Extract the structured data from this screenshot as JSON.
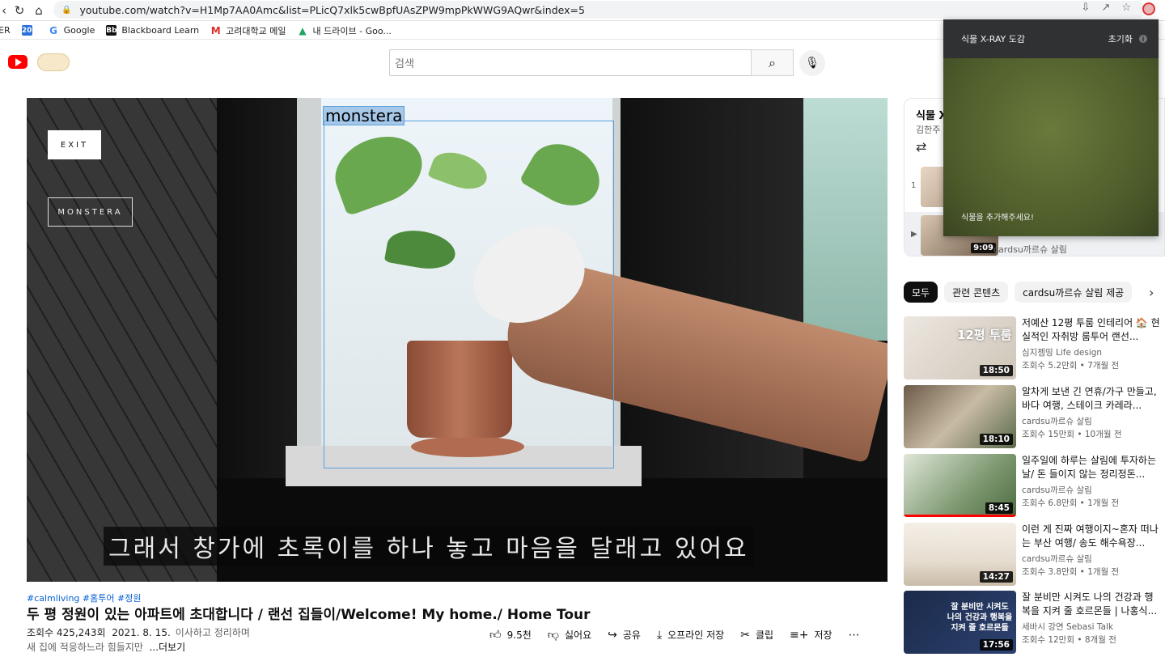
{
  "browser": {
    "url": "youtube.com/watch?v=H1Mp7AA0Amc&list=PLicQ7xlk5cwBpfUAsZPW9mpPkWWG9AQwr&index=5",
    "bookmarks": [
      {
        "label": "ER",
        "icon": "naver-icon"
      },
      {
        "label": "20",
        "icon": "calendar-icon"
      },
      {
        "label": "Google",
        "icon": "google-icon"
      },
      {
        "label": "Blackboard Learn",
        "icon": "blackboard-icon"
      },
      {
        "label": "고려대학교 메일",
        "icon": "gmail-icon"
      },
      {
        "label": "내 드라이브 - Goo...",
        "icon": "drive-icon"
      }
    ]
  },
  "header": {
    "search_placeholder": "검색"
  },
  "player": {
    "detection_label": "monstera",
    "exit_label": "EXIT",
    "tag_label": "MONSTERA",
    "caption": "그래서 창가에 초록이를 하나 놓고 마음을 달래고 있어요"
  },
  "video": {
    "hashtags": "#calmliving #홈투어 #정원",
    "title": "두 평 정원이 있는 아파트에 초대합니다 / 랜선 집들이/Welcome! My home./ Home Tour",
    "views": "조회수 425,243회",
    "date": "2021. 8. 15.",
    "desc_line1": "이사하고 정리하며",
    "desc_line2": "새 집에 적응하느라 힘들지만",
    "more": "...더보기",
    "actions": {
      "like": "9.5천",
      "dislike": "싫어요",
      "share": "공유",
      "download": "오프라인 저장",
      "clip": "클립",
      "save": "저장"
    }
  },
  "playlist": {
    "title": "식물 X-",
    "owner": "김한주",
    "item1_index": "1",
    "item2_duration": "9:09",
    "item2_channel": "cardsu까르슈 살림"
  },
  "xray_panel": {
    "title": "식물 X-RAY 도감",
    "reset": "초기화",
    "info": "i",
    "hint": "식물을 추가해주세요!"
  },
  "chips": [
    "모두",
    "관련 콘텐츠",
    "cardsu까르슈 살림 제공"
  ],
  "recommendations": [
    {
      "title": "저예산 12평 투룸 인테리어 🏠 현실적인 자취방 룸투어 랜선...",
      "channel": "심지젬띵 Life design",
      "stats": "조회수 5.2만회 • 7개월 전",
      "duration": "18:50",
      "thumb_text": "12평 투룸",
      "progress": 0
    },
    {
      "title": "알차게 보낸 긴 연휴/가구 만들고, 바다 여행, 스테이크 카레라...",
      "channel": "cardsu까르슈 살림",
      "stats": "조회수 15만회 • 10개월 전",
      "duration": "18:10",
      "thumb_text": "",
      "progress": 0
    },
    {
      "title": "일주일에 하루는 살림에 투자하는 날/ 돈 들이지 않는 정리정돈...",
      "channel": "cardsu까르슈 살림",
      "stats": "조회수 6.8만회 • 1개월 전",
      "duration": "8:45",
      "thumb_text": "",
      "progress": 1.0
    },
    {
      "title": "이런 게 진짜 여행이지~혼자 떠나는 부산 여행/ 송도 해수욕장...",
      "channel": "cardsu까르슈 살림",
      "stats": "조회수 3.8만회 • 1개월 전",
      "duration": "14:27",
      "thumb_text": "",
      "progress": 0
    },
    {
      "title": "잘 분비만 시켜도 나의 건강과 행복을 지켜 줄 호르몬들 | 나홍식...",
      "channel": "세바시 강연 Sebasi Talk",
      "stats": "조회수 12만회 • 8개월 전",
      "duration": "17:56",
      "thumb_text": "잘 분비만 시켜도 나의 건강과 행복을 지켜 줄 호르몬들",
      "progress": 0
    }
  ]
}
